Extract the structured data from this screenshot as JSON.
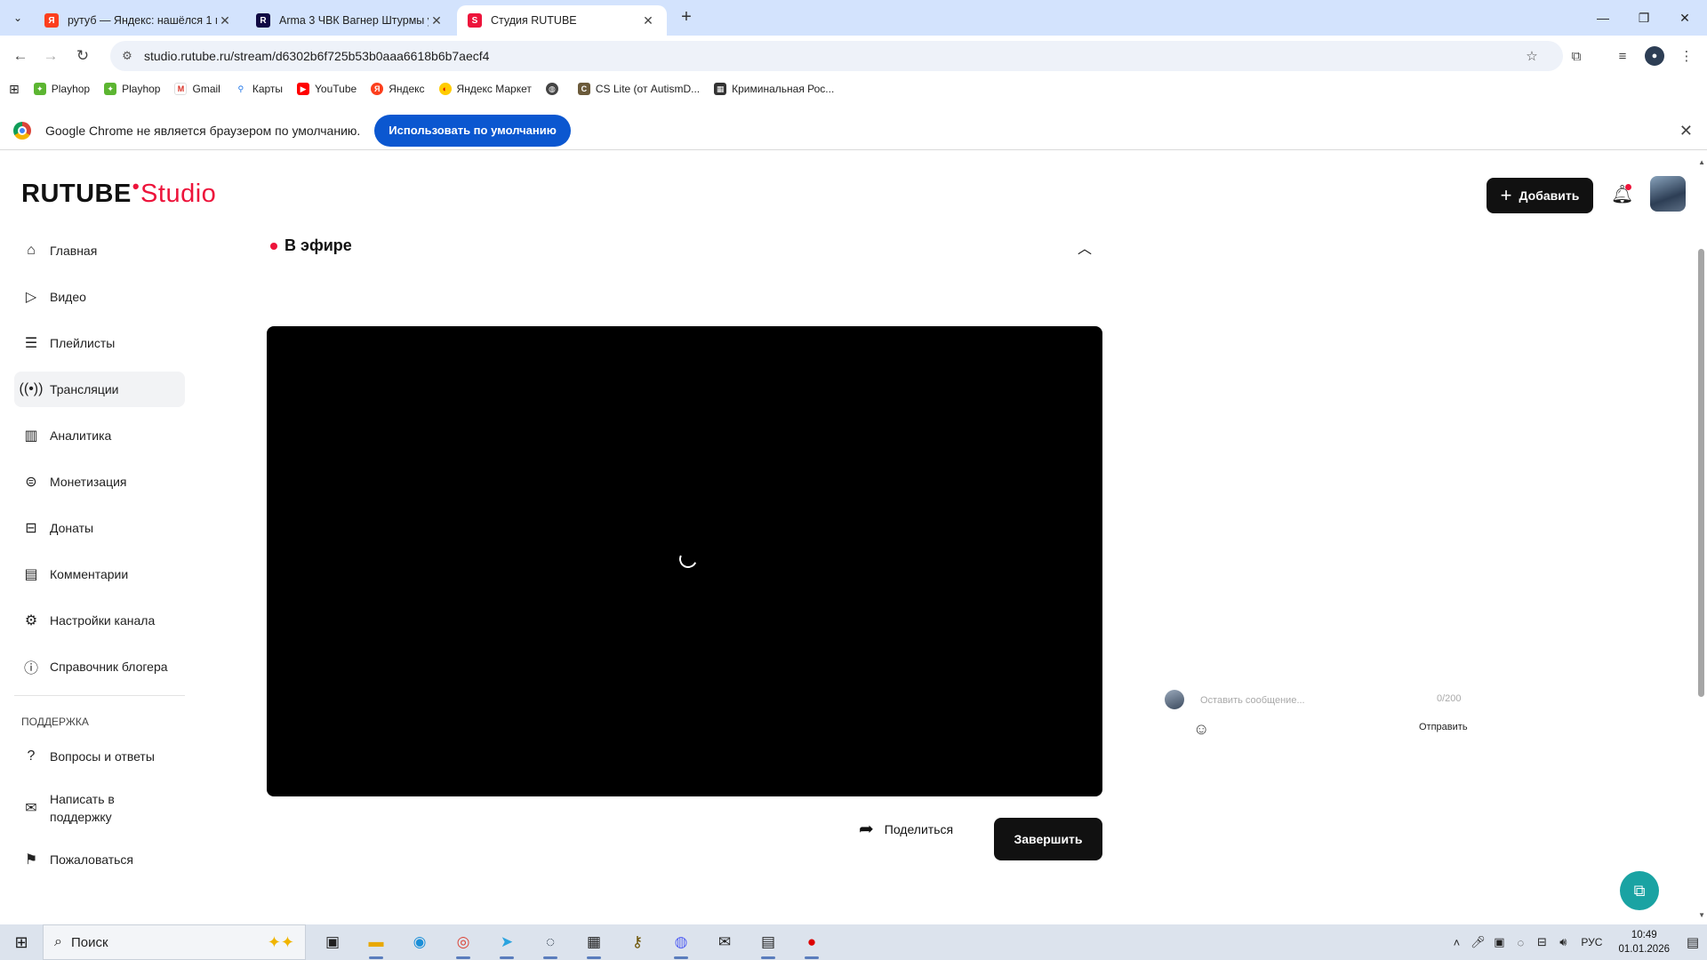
{
  "browser": {
    "tabs": [
      {
        "title": "рутуб — Яндекс: нашёлся 1 м",
        "favicon": "yandex-icon",
        "color": "#fc3f1d",
        "active": false
      },
      {
        "title": "Arma 3 ЧВК Вагнер Штурмы у",
        "favicon": "rutube-icon",
        "color": "#100943",
        "active": false
      },
      {
        "title": "Студия RUTUBE",
        "favicon": "rutube-studio-icon",
        "color": "#ed143b",
        "active": true
      }
    ],
    "url": "studio.rutube.ru/stream/d6302b6f725b53b0aaa6618b6b7aecf4",
    "bookmarks": [
      {
        "label": "",
        "icon": "apps-grid-icon"
      },
      {
        "label": "Playhop",
        "icon": "playhop-icon"
      },
      {
        "label": "Playhop",
        "icon": "playhop-icon"
      },
      {
        "label": "Gmail",
        "icon": "gmail-icon"
      },
      {
        "label": "Карты",
        "icon": "maps-pin-icon"
      },
      {
        "label": "YouTube",
        "icon": "youtube-icon"
      },
      {
        "label": "Яндекс",
        "icon": "yandex-icon"
      },
      {
        "label": "Яндекс Маркет",
        "icon": "market-icon"
      },
      {
        "label": "",
        "icon": "globe-icon"
      },
      {
        "label": "CS Lite (от AutismD...",
        "icon": "cs-icon"
      },
      {
        "label": "Криминальная Рос...",
        "icon": "folder-icon"
      }
    ],
    "infobar": {
      "text": "Google Chrome не является браузером по умолчанию.",
      "button": "Использовать по умолчанию"
    }
  },
  "studio": {
    "logo_main": "RUTUBE",
    "logo_studio": "Studio",
    "add_button": "Добавить",
    "nav": [
      {
        "label": "Главная",
        "icon": "home-icon",
        "active": false
      },
      {
        "label": "Видео",
        "icon": "video-icon",
        "active": false
      },
      {
        "label": "Плейлисты",
        "icon": "playlist-icon",
        "active": false
      },
      {
        "label": "Трансляции",
        "icon": "broadcast-icon",
        "active": true
      },
      {
        "label": "Аналитика",
        "icon": "analytics-icon",
        "active": false
      },
      {
        "label": "Монетизация",
        "icon": "money-icon",
        "active": false
      },
      {
        "label": "Донаты",
        "icon": "donate-icon",
        "active": false
      },
      {
        "label": "Комментарии",
        "icon": "comment-icon",
        "active": false
      },
      {
        "label": "Настройки канала",
        "icon": "gear-icon",
        "active": false
      },
      {
        "label": "Справочник блогера",
        "icon": "info-icon",
        "active": false
      }
    ],
    "support_label": "ПОДДЕРЖКА",
    "support_nav": [
      {
        "label": "Вопросы и ответы",
        "icon": "question-icon"
      },
      {
        "label": "Написать в поддержку",
        "icon": "mail-icon"
      },
      {
        "label": "Пожаловаться",
        "icon": "flag-icon"
      }
    ],
    "live_title": "В эфире",
    "share_label": "Поделиться",
    "finish_label": "Завершить",
    "chat": {
      "placeholder": "Оставить сообщение...",
      "counter": "0/200",
      "send_label": "Отправить"
    },
    "accent": "#ed143b"
  },
  "taskbar": {
    "search_label": "Поиск",
    "lang": "РУС",
    "time": "10:49",
    "date": "01.01.2026"
  }
}
